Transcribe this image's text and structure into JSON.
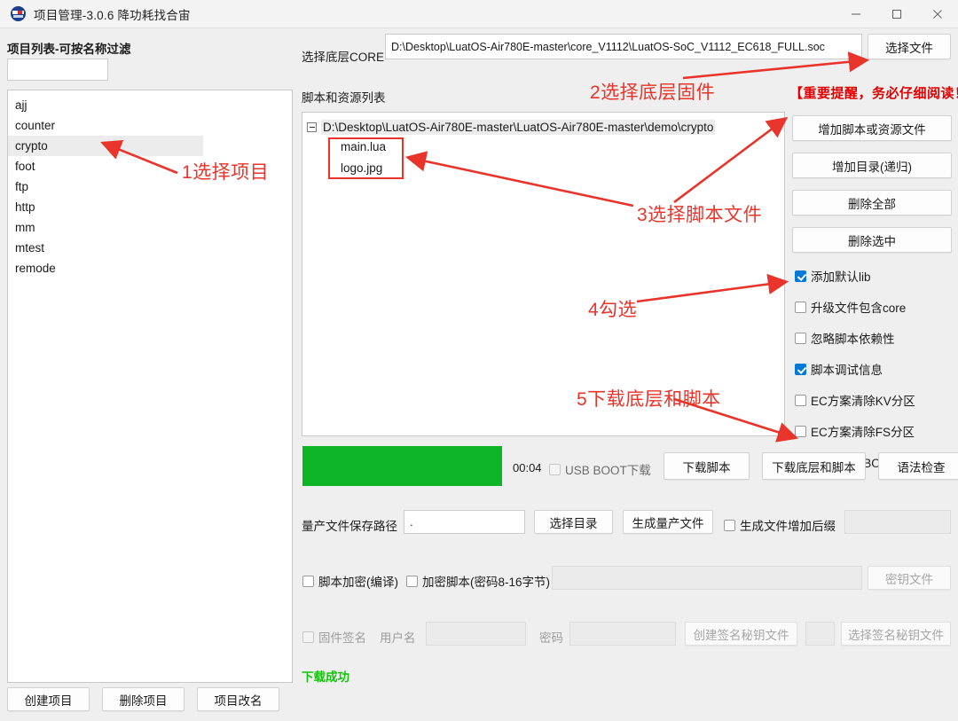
{
  "window": {
    "title": "项目管理-3.0.6 降功耗找合宙",
    "icon": "app-logo-icon",
    "controls": {
      "minimize": "minimize-icon",
      "maximize": "maximize-icon",
      "close": "close-icon"
    }
  },
  "left_panel": {
    "projects_label": "项目列表-可按名称过滤",
    "filter_value": "",
    "filter_placeholder": "",
    "projects": [
      {
        "name": "ajj",
        "selected": false
      },
      {
        "name": "counter",
        "selected": false
      },
      {
        "name": "crypto",
        "selected": true
      },
      {
        "name": "foot",
        "selected": false
      },
      {
        "name": "ftp",
        "selected": false
      },
      {
        "name": "http",
        "selected": false
      },
      {
        "name": "mm",
        "selected": false
      },
      {
        "name": "mtest",
        "selected": false
      },
      {
        "name": "remode",
        "selected": false
      }
    ],
    "buttons": {
      "create": "创建项目",
      "delete": "删除项目",
      "rename": "项目改名"
    }
  },
  "core_row": {
    "label": "选择底层CORE",
    "path": "D:\\Desktop\\LuatOS-Air780E-master\\core_V1112\\LuatOS-SoC_V1112_EC618_FULL.soc",
    "button": "选择文件"
  },
  "tree": {
    "label": "脚本和资源列表",
    "root": "D:\\Desktop\\LuatOS-Air780E-master\\LuatOS-Air780E-master\\demo\\crypto",
    "children": [
      "main.lua",
      "logo.jpg"
    ]
  },
  "side_buttons": [
    {
      "label": "增加脚本或资源文件"
    },
    {
      "label": "增加目录(递归)"
    },
    {
      "label": "删除全部"
    },
    {
      "label": "删除选中"
    }
  ],
  "side_checkboxes": [
    {
      "label": "添加默认lib",
      "checked": true
    },
    {
      "label": "升级文件包含core",
      "checked": false
    },
    {
      "label": "忽略脚本依赖性",
      "checked": false
    },
    {
      "label": "脚本调试信息",
      "checked": true
    },
    {
      "label": "EC方案清除KV分区",
      "checked": false
    },
    {
      "label": "EC方案清除FS分区",
      "checked": false
    },
    {
      "label": "EC方案免BOOT刷脚本",
      "checked": false
    }
  ],
  "progress_row": {
    "progress_percent": 100,
    "progress_color": "#0cb526",
    "timer": "00:04",
    "usb_boot": {
      "label": "USB BOOT下载",
      "checked": false,
      "disabled": true
    },
    "buttons": {
      "download_script": "下载脚本",
      "download_all": "下载底层和脚本",
      "syntax_check": "语法检查"
    }
  },
  "mass_row": {
    "label": "量产文件保存路径",
    "path_value": ".",
    "choose_dir": "选择目录",
    "generate": "生成量产文件",
    "suffix_checkbox": {
      "label": "生成文件增加后缀",
      "checked": false
    },
    "suffix_value": ""
  },
  "encrypt_row": {
    "compile_checkbox": {
      "label": "脚本加密(编译)",
      "checked": false
    },
    "encrypt_checkbox": {
      "label": "加密脚本(密码8-16字节)",
      "checked": false
    },
    "password_value": "",
    "key_file_button": "密钥文件"
  },
  "sign_row": {
    "sign_checkbox": {
      "label": "固件签名",
      "checked": false,
      "disabled": true
    },
    "user_label": "用户名",
    "user_value": "",
    "password_label": "密码",
    "password_value": "",
    "create_key_button": "创建签名秘钥文件",
    "key_value": "",
    "select_key_button": "选择签名秘钥文件"
  },
  "status": {
    "message": "下载成功",
    "color": "#13c40a"
  },
  "annotations": {
    "step1": "1选择项目",
    "step2": "2选择底层固件",
    "step3": "3选择脚本文件",
    "step4": "4勾选",
    "step5": "5下载底层和脚本",
    "warning": "【重要提醒，务必仔细阅读！】",
    "color": "#e8342a"
  }
}
